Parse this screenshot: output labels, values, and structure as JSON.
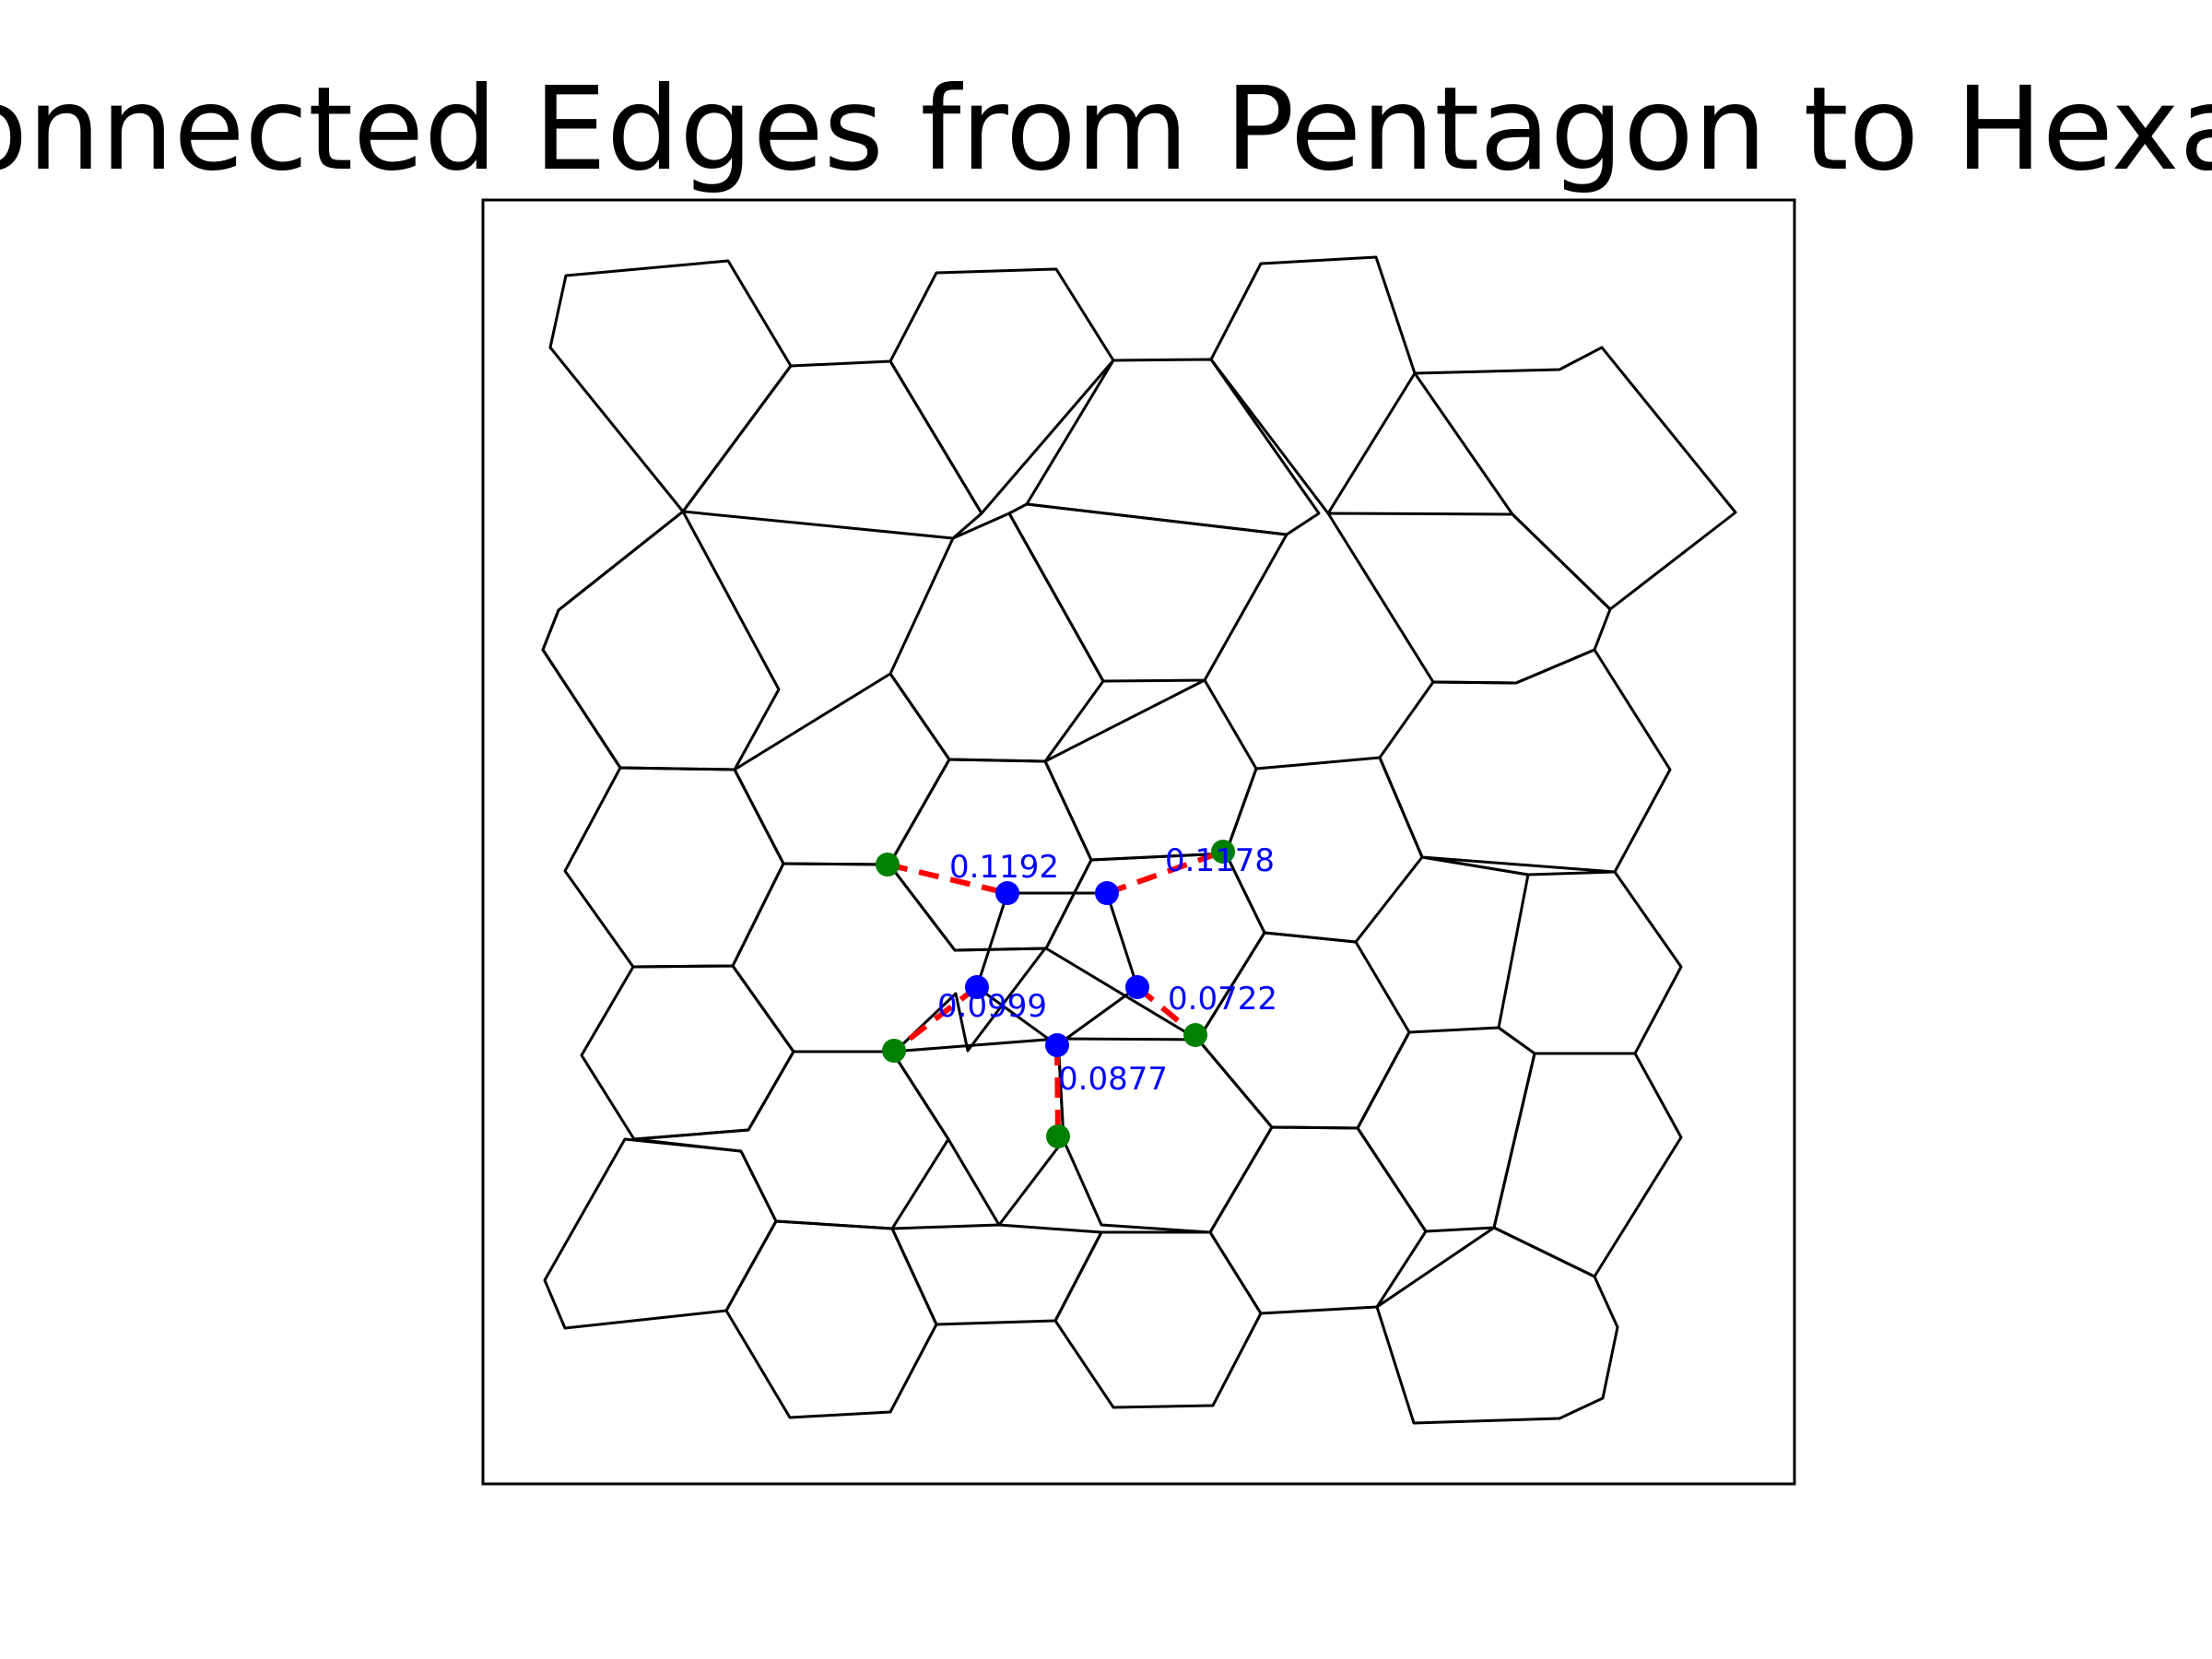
{
  "title": "Disconnected Edges from Pentagon to Hexagons",
  "colors": {
    "cell_edge": "#000000",
    "pentagon_vertex": "#0000ff",
    "hexagon_vertex": "#008000",
    "connector": "#ff0000",
    "label": "#0000ff"
  },
  "edge_labels": [
    "0.1192",
    "0.1178",
    "0.0722",
    "0.0877",
    "0.0999"
  ]
}
